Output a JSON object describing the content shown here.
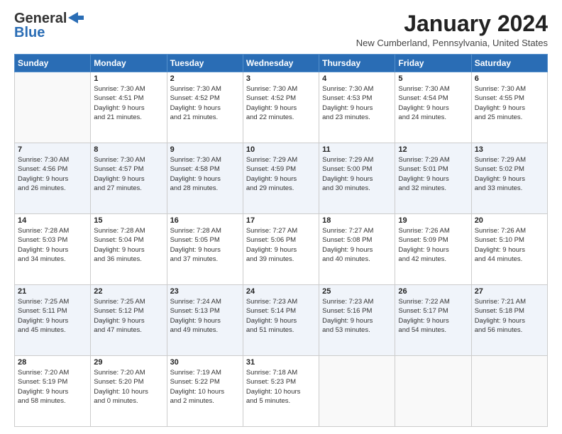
{
  "header": {
    "logo_line1": "General",
    "logo_line2": "Blue",
    "month_year": "January 2024",
    "location": "New Cumberland, Pennsylvania, United States"
  },
  "weekdays": [
    "Sunday",
    "Monday",
    "Tuesday",
    "Wednesday",
    "Thursday",
    "Friday",
    "Saturday"
  ],
  "weeks": [
    [
      {
        "day": "",
        "info": ""
      },
      {
        "day": "1",
        "info": "Sunrise: 7:30 AM\nSunset: 4:51 PM\nDaylight: 9 hours\nand 21 minutes."
      },
      {
        "day": "2",
        "info": "Sunrise: 7:30 AM\nSunset: 4:52 PM\nDaylight: 9 hours\nand 21 minutes."
      },
      {
        "day": "3",
        "info": "Sunrise: 7:30 AM\nSunset: 4:52 PM\nDaylight: 9 hours\nand 22 minutes."
      },
      {
        "day": "4",
        "info": "Sunrise: 7:30 AM\nSunset: 4:53 PM\nDaylight: 9 hours\nand 23 minutes."
      },
      {
        "day": "5",
        "info": "Sunrise: 7:30 AM\nSunset: 4:54 PM\nDaylight: 9 hours\nand 24 minutes."
      },
      {
        "day": "6",
        "info": "Sunrise: 7:30 AM\nSunset: 4:55 PM\nDaylight: 9 hours\nand 25 minutes."
      }
    ],
    [
      {
        "day": "7",
        "info": "Sunrise: 7:30 AM\nSunset: 4:56 PM\nDaylight: 9 hours\nand 26 minutes."
      },
      {
        "day": "8",
        "info": "Sunrise: 7:30 AM\nSunset: 4:57 PM\nDaylight: 9 hours\nand 27 minutes."
      },
      {
        "day": "9",
        "info": "Sunrise: 7:30 AM\nSunset: 4:58 PM\nDaylight: 9 hours\nand 28 minutes."
      },
      {
        "day": "10",
        "info": "Sunrise: 7:29 AM\nSunset: 4:59 PM\nDaylight: 9 hours\nand 29 minutes."
      },
      {
        "day": "11",
        "info": "Sunrise: 7:29 AM\nSunset: 5:00 PM\nDaylight: 9 hours\nand 30 minutes."
      },
      {
        "day": "12",
        "info": "Sunrise: 7:29 AM\nSunset: 5:01 PM\nDaylight: 9 hours\nand 32 minutes."
      },
      {
        "day": "13",
        "info": "Sunrise: 7:29 AM\nSunset: 5:02 PM\nDaylight: 9 hours\nand 33 minutes."
      }
    ],
    [
      {
        "day": "14",
        "info": "Sunrise: 7:28 AM\nSunset: 5:03 PM\nDaylight: 9 hours\nand 34 minutes."
      },
      {
        "day": "15",
        "info": "Sunrise: 7:28 AM\nSunset: 5:04 PM\nDaylight: 9 hours\nand 36 minutes."
      },
      {
        "day": "16",
        "info": "Sunrise: 7:28 AM\nSunset: 5:05 PM\nDaylight: 9 hours\nand 37 minutes."
      },
      {
        "day": "17",
        "info": "Sunrise: 7:27 AM\nSunset: 5:06 PM\nDaylight: 9 hours\nand 39 minutes."
      },
      {
        "day": "18",
        "info": "Sunrise: 7:27 AM\nSunset: 5:08 PM\nDaylight: 9 hours\nand 40 minutes."
      },
      {
        "day": "19",
        "info": "Sunrise: 7:26 AM\nSunset: 5:09 PM\nDaylight: 9 hours\nand 42 minutes."
      },
      {
        "day": "20",
        "info": "Sunrise: 7:26 AM\nSunset: 5:10 PM\nDaylight: 9 hours\nand 44 minutes."
      }
    ],
    [
      {
        "day": "21",
        "info": "Sunrise: 7:25 AM\nSunset: 5:11 PM\nDaylight: 9 hours\nand 45 minutes."
      },
      {
        "day": "22",
        "info": "Sunrise: 7:25 AM\nSunset: 5:12 PM\nDaylight: 9 hours\nand 47 minutes."
      },
      {
        "day": "23",
        "info": "Sunrise: 7:24 AM\nSunset: 5:13 PM\nDaylight: 9 hours\nand 49 minutes."
      },
      {
        "day": "24",
        "info": "Sunrise: 7:23 AM\nSunset: 5:14 PM\nDaylight: 9 hours\nand 51 minutes."
      },
      {
        "day": "25",
        "info": "Sunrise: 7:23 AM\nSunset: 5:16 PM\nDaylight: 9 hours\nand 53 minutes."
      },
      {
        "day": "26",
        "info": "Sunrise: 7:22 AM\nSunset: 5:17 PM\nDaylight: 9 hours\nand 54 minutes."
      },
      {
        "day": "27",
        "info": "Sunrise: 7:21 AM\nSunset: 5:18 PM\nDaylight: 9 hours\nand 56 minutes."
      }
    ],
    [
      {
        "day": "28",
        "info": "Sunrise: 7:20 AM\nSunset: 5:19 PM\nDaylight: 9 hours\nand 58 minutes."
      },
      {
        "day": "29",
        "info": "Sunrise: 7:20 AM\nSunset: 5:20 PM\nDaylight: 10 hours\nand 0 minutes."
      },
      {
        "day": "30",
        "info": "Sunrise: 7:19 AM\nSunset: 5:22 PM\nDaylight: 10 hours\nand 2 minutes."
      },
      {
        "day": "31",
        "info": "Sunrise: 7:18 AM\nSunset: 5:23 PM\nDaylight: 10 hours\nand 5 minutes."
      },
      {
        "day": "",
        "info": ""
      },
      {
        "day": "",
        "info": ""
      },
      {
        "day": "",
        "info": ""
      }
    ]
  ]
}
